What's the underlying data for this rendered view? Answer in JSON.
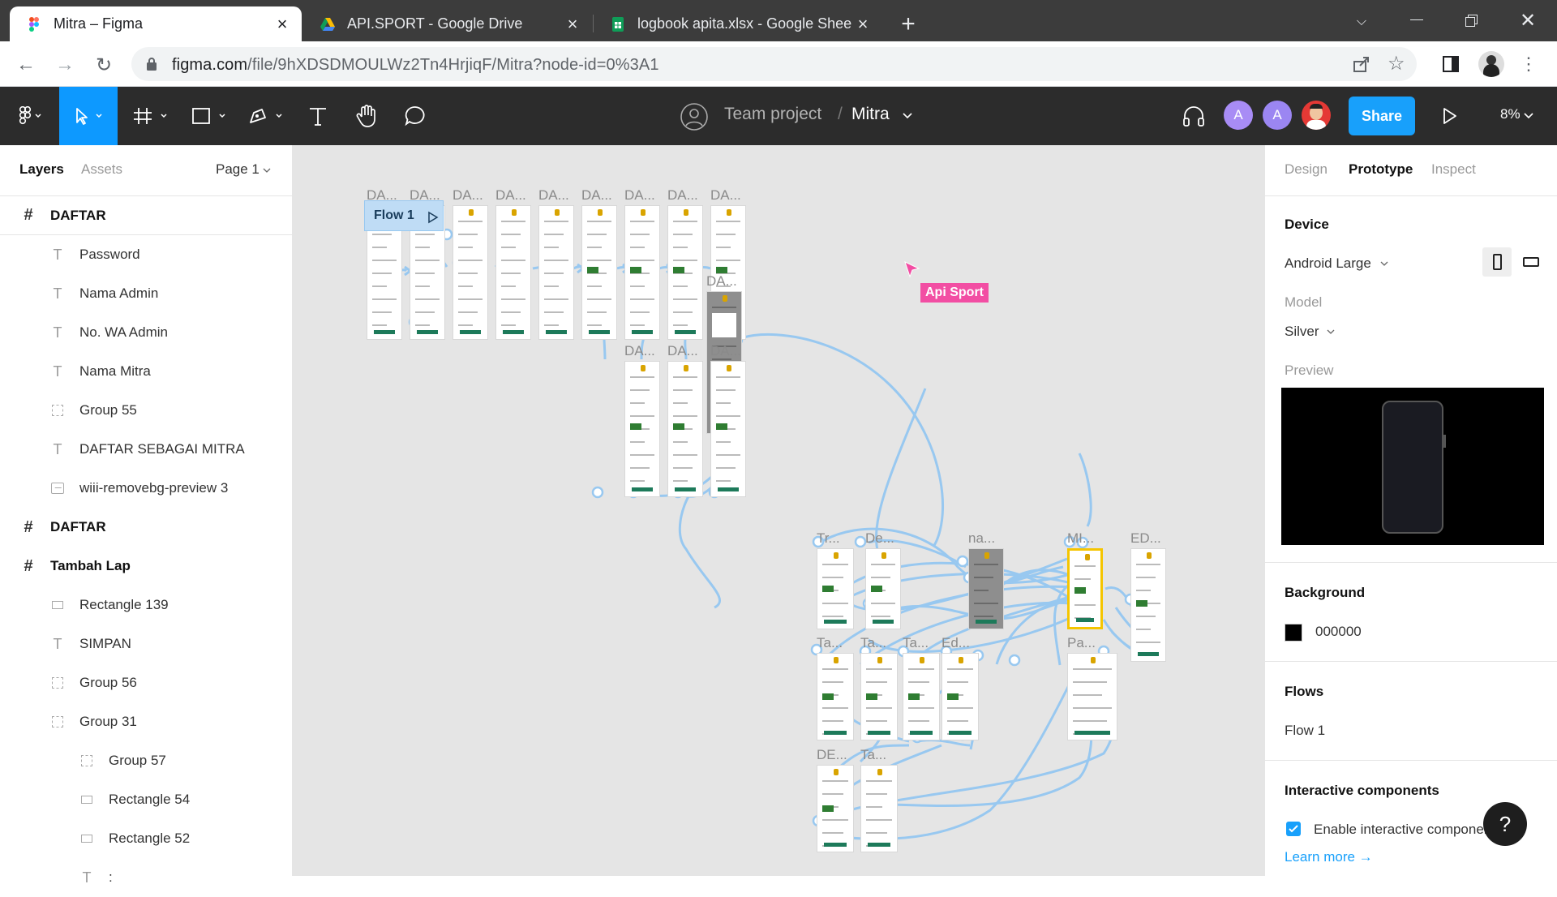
{
  "browser": {
    "tabs": [
      {
        "title": "Mitra – Figma",
        "icon": "figma-icon",
        "active": true
      },
      {
        "title": "API.SPORT - Google Drive",
        "icon": "google-drive-icon",
        "active": false
      },
      {
        "title": "logbook apita.xlsx - Google Shee",
        "icon": "google-sheets-icon",
        "active": false
      }
    ],
    "url_host": "figma.com",
    "url_path": "/file/9hXDSDMOULWz2Tn4HrjiqF/Mitra?node-id=0%3A1"
  },
  "figma": {
    "team": "Team project",
    "separator": "/",
    "file": "Mitra",
    "avatars": [
      "A",
      "A"
    ],
    "share_label": "Share",
    "zoom": "8%",
    "colors": {
      "accent": "#18a0fb",
      "toolbar": "#2c2c2c",
      "avatar1": "#a88cf5",
      "avatar2": "#9b86f2",
      "flow": "#98c8f0",
      "selection": "#f5c500",
      "pointer": "#f24ea3"
    }
  },
  "left_panel": {
    "tabs": {
      "layers": "Layers",
      "assets": "Assets"
    },
    "page": "Page 1",
    "layers": [
      {
        "name": "DAFTAR",
        "type": "frame",
        "indent": 0
      },
      {
        "name": "Password",
        "type": "text",
        "indent": 1
      },
      {
        "name": "Nama Admin",
        "type": "text",
        "indent": 1
      },
      {
        "name": "No. WA Admin",
        "type": "text",
        "indent": 1
      },
      {
        "name": "Nama Mitra",
        "type": "text",
        "indent": 1
      },
      {
        "name": "Group 55",
        "type": "group",
        "indent": 1
      },
      {
        "name": "DAFTAR SEBAGAI MITRA",
        "type": "text",
        "indent": 1
      },
      {
        "name": "wiii-removebg-preview 3",
        "type": "image",
        "indent": 1
      },
      {
        "name": "DAFTAR",
        "type": "frame",
        "indent": 0
      },
      {
        "name": "Tambah Lap",
        "type": "frame",
        "indent": 0
      },
      {
        "name": "Rectangle 139",
        "type": "rect",
        "indent": 1
      },
      {
        "name": "SIMPAN",
        "type": "text",
        "indent": 1
      },
      {
        "name": "Group 56",
        "type": "group",
        "indent": 1
      },
      {
        "name": "Group 31",
        "type": "group",
        "indent": 1
      },
      {
        "name": "Group 57",
        "type": "group",
        "indent": 2
      },
      {
        "name": "Rectangle 54",
        "type": "rect",
        "indent": 2
      },
      {
        "name": "Rectangle 52",
        "type": "rect",
        "indent": 2
      },
      {
        "name": ":",
        "type": "text",
        "indent": 2
      }
    ]
  },
  "canvas": {
    "flow_label": "Flow 1",
    "pointer_label": "Api Sport",
    "frame_labels": [
      "DA...",
      "DA...",
      "DA...",
      "DA...",
      "DA...",
      "DA...",
      "DA...",
      "DA...",
      "DA...",
      "DA...",
      "DA...",
      "DA...",
      "DA...",
      "Tr...",
      "De...",
      "na...",
      "MI...",
      "ED...",
      "Ta...",
      "Ta...",
      "Ta...",
      "Ed...",
      "Pa...",
      "DE...",
      "Ta..."
    ]
  },
  "right_panel": {
    "tabs": {
      "design": "Design",
      "prototype": "Prototype",
      "inspect": "Inspect"
    },
    "device_header": "Device",
    "device": "Android Large",
    "model_label": "Model",
    "model": "Silver",
    "preview_label": "Preview",
    "background_header": "Background",
    "background_hex": "000000",
    "flows_header": "Flows",
    "flow_name": "Flow 1",
    "interactive_header": "Interactive components",
    "enable_label": "Enable interactive components",
    "enable_checked": true,
    "learn_more": "Learn more →",
    "help": "?"
  }
}
